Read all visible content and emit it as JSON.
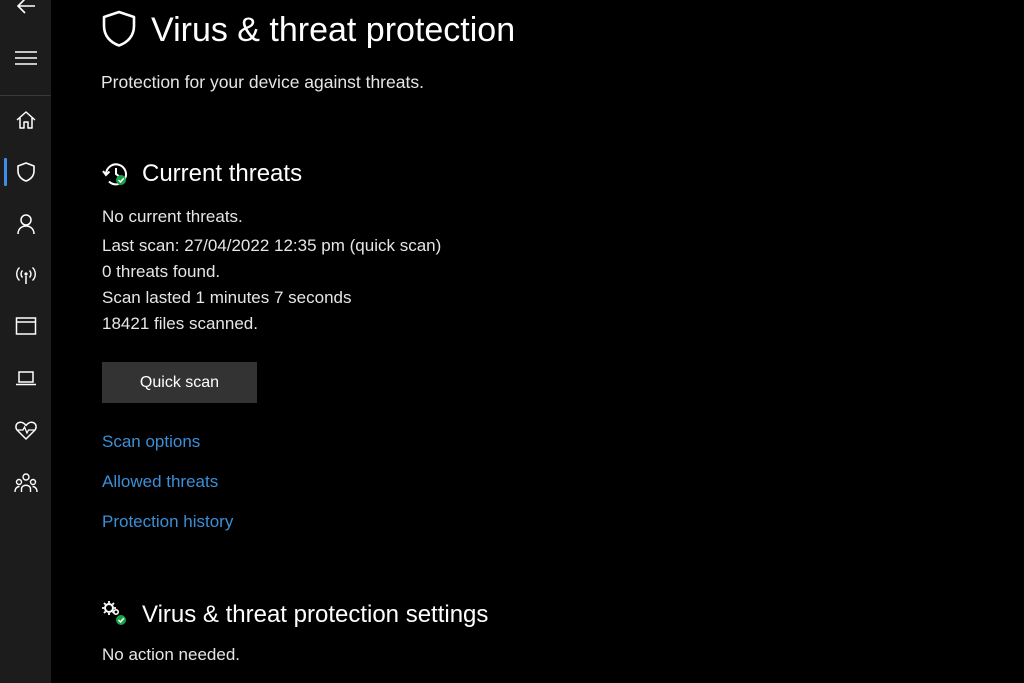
{
  "page": {
    "title": "Virus & threat protection",
    "subtitle": "Protection for your device against threats."
  },
  "sidebar": {
    "accent": "#3b8eea",
    "items": [
      {
        "name": "back",
        "icon": "back-arrow-icon"
      },
      {
        "name": "menu",
        "icon": "hamburger-menu-icon"
      },
      {
        "name": "home",
        "icon": "home-icon"
      },
      {
        "name": "virus-threat-protection",
        "icon": "shield-icon",
        "active": true
      },
      {
        "name": "account-protection",
        "icon": "person-icon"
      },
      {
        "name": "firewall-network-protection",
        "icon": "antenna-icon"
      },
      {
        "name": "app-browser-control",
        "icon": "browser-window-icon"
      },
      {
        "name": "device-security",
        "icon": "laptop-icon"
      },
      {
        "name": "device-performance-health",
        "icon": "heart-icon"
      },
      {
        "name": "family-options",
        "icon": "family-icon"
      }
    ]
  },
  "current_threats": {
    "title": "Current threats",
    "icon": "history-check-icon",
    "status": "No current threats.",
    "last_scan": "Last scan: 27/04/2022 12:35 pm (quick scan)",
    "threats_found": "0 threats found.",
    "scan_duration": "Scan lasted 1 minutes 7 seconds",
    "files_scanned": "18421 files scanned.",
    "quick_scan_label": "Quick scan",
    "links": {
      "scan_options": "Scan options",
      "allowed_threats": "Allowed threats",
      "protection_history": "Protection history"
    }
  },
  "settings": {
    "title": "Virus & threat protection settings",
    "icon": "gears-check-icon",
    "status": "No action needed."
  },
  "colors": {
    "background": "#000000",
    "sidebar": "#1c1c1c",
    "link": "#3a8fd8",
    "button": "#333333",
    "ok_badge": "#16a34a"
  }
}
